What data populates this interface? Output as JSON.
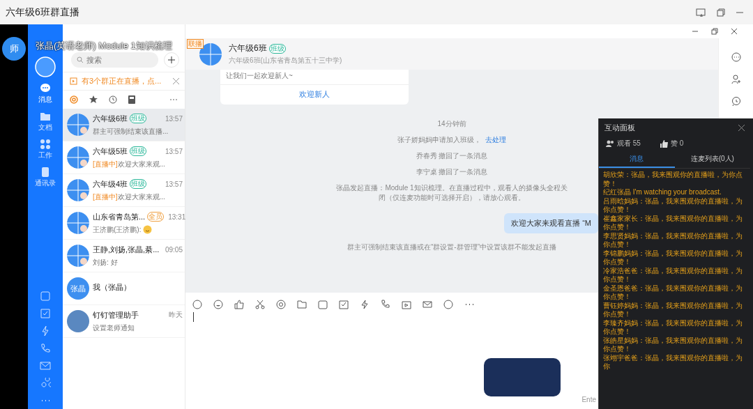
{
  "window": {
    "title": "六年级6班群直播"
  },
  "live_overlay": {
    "avatar": "师",
    "caption": "张晶(英语老师) Module 1知识梳理"
  },
  "nav": {
    "items": [
      {
        "label": "消息",
        "selected": true
      },
      {
        "label": "文档",
        "selected": false
      },
      {
        "label": "工作",
        "selected": false
      },
      {
        "label": "通讯录",
        "selected": false
      }
    ]
  },
  "chat_list": {
    "search": {
      "placeholder": "搜索"
    },
    "banner": "有3个群正在直播，点...",
    "items": [
      {
        "name": "六年级6班",
        "tag": {
          "label": "班级",
          "color": "#2bb89a"
        },
        "time": "13:57",
        "preview": "群主可强制结束该直播...",
        "kind": "group",
        "selected": true
      },
      {
        "name": "六年级5班",
        "tag": {
          "label": "班级",
          "color": "#2bb89a"
        },
        "time": "13:57",
        "prefix": "[直播中]",
        "preview": "欢迎大家来观...",
        "kind": "group",
        "selected": false
      },
      {
        "name": "六年级4班",
        "tag": {
          "label": "班级",
          "color": "#2bb89a"
        },
        "time": "13:57",
        "prefix": "[直播中]",
        "preview": "欢迎大家来观...",
        "kind": "group",
        "selected": false
      },
      {
        "name": "山东省青岛第...",
        "tag": {
          "label": "全员",
          "color": "#f0a040"
        },
        "time": "13:31",
        "preview": "王济鹏(王济鹏):",
        "emoji": true,
        "kind": "group",
        "selected": false
      },
      {
        "name": "王静,刘扬,张晶,綦...",
        "time": "09:05",
        "preview": "刘扬: 好",
        "kind": "group",
        "selected": false
      },
      {
        "name": "我（张晶）",
        "kind": "text",
        "avatar_text": "张晶",
        "selected": false
      },
      {
        "name": "钉钉管理助手",
        "time": "昨天",
        "preview": "设置老师通知",
        "kind": "photo",
        "selected": false
      }
    ]
  },
  "chat": {
    "live_tag": "联播",
    "title": "六年级6班",
    "tag": {
      "label": "班级",
      "color": "#2bb89a"
    },
    "subtitle": "六年级6班(山东省青岛第五十三中学)",
    "welcome_card": {
      "text": "让我们一起欢迎新人~",
      "link": "欢迎新人"
    },
    "messages": [
      {
        "kind": "time",
        "text": "14分钟前"
      },
      {
        "kind": "system",
        "text": "张子娇妈妈申请加入班级，",
        "link": "去处理"
      },
      {
        "kind": "system",
        "text": "乔春秀 撤回了一条消息"
      },
      {
        "kind": "system",
        "text": "李宁桌 撤回了一条消息"
      },
      {
        "kind": "system",
        "text": "张晶发起直播：Module 1知识梳理。在直播过程中，观看人的摄像头全程关闭（仅连麦功能时可选择开启），请放心观看。"
      },
      {
        "kind": "bubble",
        "text": "欢迎大家来观看直播 “M"
      },
      {
        "kind": "system",
        "text": "群主可强制结束该直播或在“群设置-群管理”中设置该群不能发起直播"
      }
    ],
    "send_hint": "Ente"
  },
  "panel": {
    "title": "互动面板",
    "viewers": "观看 55",
    "likes": "赞 0",
    "tabs": [
      {
        "label": "消息",
        "selected": true
      },
      {
        "label": "连麦列表(0人)",
        "selected": false
      }
    ],
    "comments": [
      "胡欣荣：张晶，我来围观你的直播啦，为你点赞！",
      "纪红张晶 I'm watching your broadcast.",
      "吕雨晗妈妈：张晶，我来围观你的直播啦，为你点赞！",
      "崔鑫家家长：张晶，我来围观你的直播啦，为你点赞！",
      "李思贤妈妈：张晶，我来围观你的直播啦，为你点赞！",
      "李锦鹏妈妈：张晶，我来围观你的直播啦，为你点赞！",
      "冷家浩爸爸：张晶，我来围观你的直播啦，为你点赞！",
      "金圣恩爸爸：张晶，我来围观你的直播啦，为你点赞！",
      "曹钰婷妈妈：张晶，我来围观你的直播啦，为你点赞！",
      "李臻齐妈妈：张晶，我来围观你的直播啦，为你点赞！",
      "张皓星妈妈：张晶，我来围观你的直播啦，为你点赞！",
      "张翊宇爸爸：张晶，我来围观你的直播啦，为你"
    ]
  }
}
